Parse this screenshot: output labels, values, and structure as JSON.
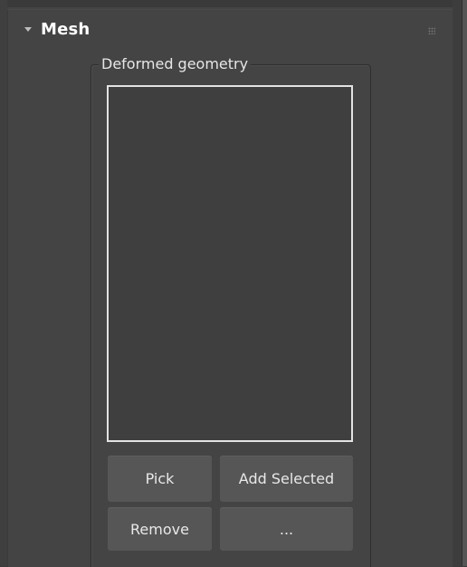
{
  "rollout": {
    "title": "Mesh",
    "collapse_icon": "triangle-down-icon",
    "handle_icon": "drag-dots-icon"
  },
  "group": {
    "label": "Deformed geometry",
    "items": []
  },
  "buttons": {
    "pick": "Pick",
    "add_selected": "Add Selected",
    "remove": "Remove",
    "more": "..."
  },
  "colors": {
    "panel": "#444444",
    "button": "#565656",
    "listbox": "#3f3f3f",
    "listbox_border": "#e3e3e3"
  }
}
